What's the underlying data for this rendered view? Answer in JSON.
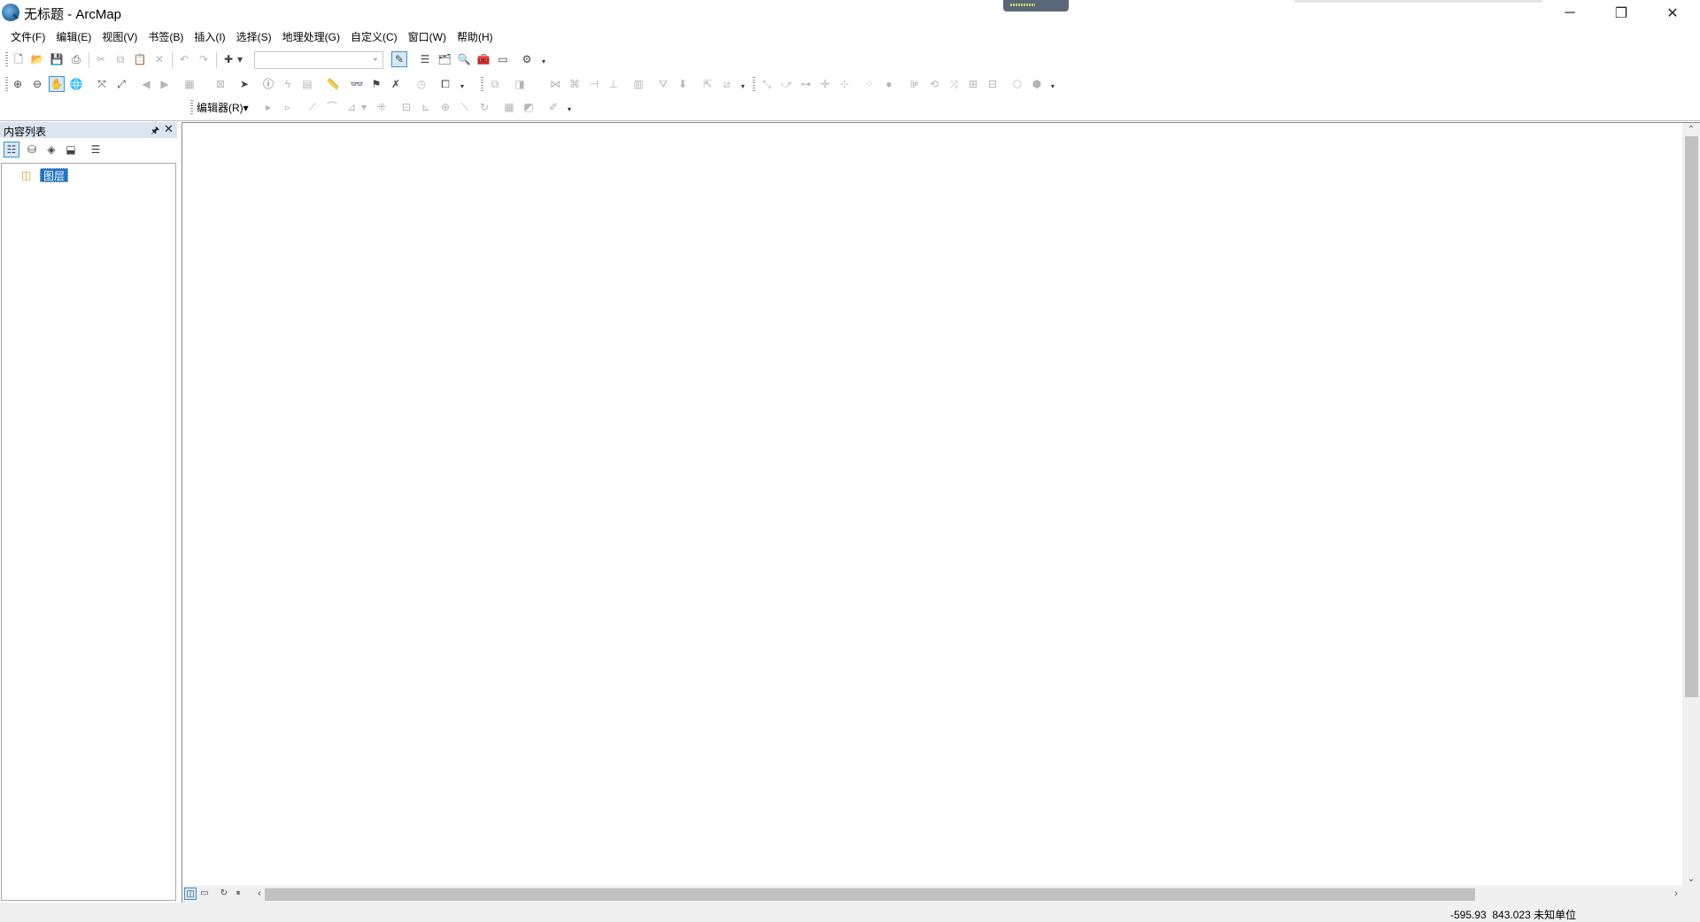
{
  "window": {
    "title": "无标题 - ArcMap",
    "minimize_glyph": "─",
    "maximize_glyph": "❐",
    "close_glyph": "✕"
  },
  "menu": {
    "items": [
      "文件(F)",
      "编辑(E)",
      "视图(V)",
      "书签(B)",
      "插入(I)",
      "选择(S)",
      "地理处理(G)",
      "自定义(C)",
      "窗口(W)",
      "帮助(H)"
    ]
  },
  "standard_toolbar": {
    "scale_value": ""
  },
  "editor_toolbar": {
    "editor_label": "编辑器(R)▾"
  },
  "toc": {
    "title": "内容列表",
    "pin_glyph": "🖈",
    "close_glyph": "✕",
    "root_layer": "图层"
  },
  "status": {
    "coords": "-595.93  843.023 未知单位"
  },
  "colors": {
    "selection": "#1e73c8",
    "panel_header": "#dbe4f1",
    "chrome": "#f0f0f0"
  }
}
